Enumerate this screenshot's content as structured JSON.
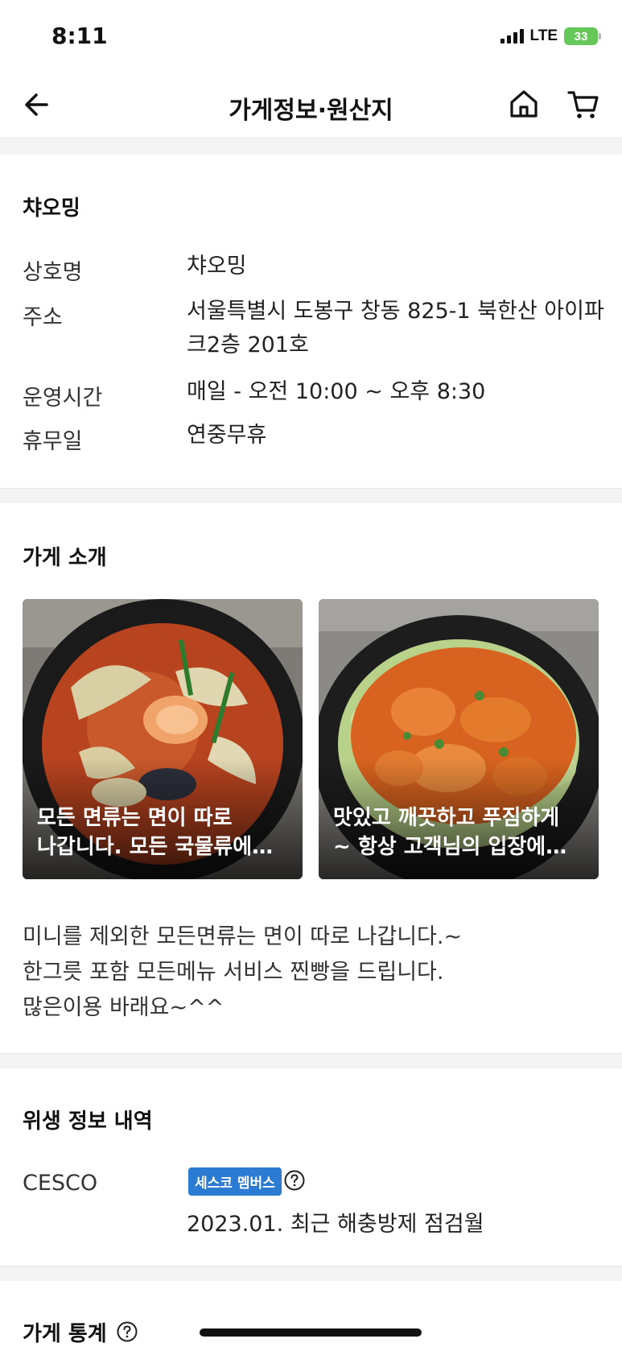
{
  "status_bar": {
    "time": "8:11",
    "network": "LTE",
    "battery": "33"
  },
  "nav": {
    "title": "가게정보·원산지"
  },
  "store_info": {
    "store_name": "챠오밍",
    "rows": [
      {
        "label": "상호명",
        "value": "챠오밍"
      },
      {
        "label": "주소",
        "value": "서울특별시 도봉구 창동 825-1 북한산 아이파크2층 201호"
      },
      {
        "label": "운영시간",
        "value": "매일 - 오전 10:00 ~ 오후 8:30"
      },
      {
        "label": "휴무일",
        "value": "연중무휴"
      }
    ]
  },
  "introduction": {
    "title": "가게 소개",
    "cards": [
      {
        "caption_line1": "모든 면류는 면이 따로",
        "caption_line2": "나갑니다. 모든 국물류에…"
      },
      {
        "caption_line1": "맛있고 깨끗하고 푸짐하게",
        "caption_line2": "~ 항상 고객님의 입장에…"
      }
    ],
    "text_lines": [
      "미니를 제외한 모든면류는 면이 따로 나갑니다.~",
      "한그릇 포함 모든메뉴 서비스 찐빵을 드립니다.",
      "많은이용 바래요~^^"
    ]
  },
  "hygiene": {
    "title": "위생 정보 내역",
    "provider": "CESCO",
    "badge": "세스코 멤버스",
    "date_text": "2023.01. 최근 해충방제 점검월"
  },
  "stats": {
    "title": "가게 통계"
  }
}
